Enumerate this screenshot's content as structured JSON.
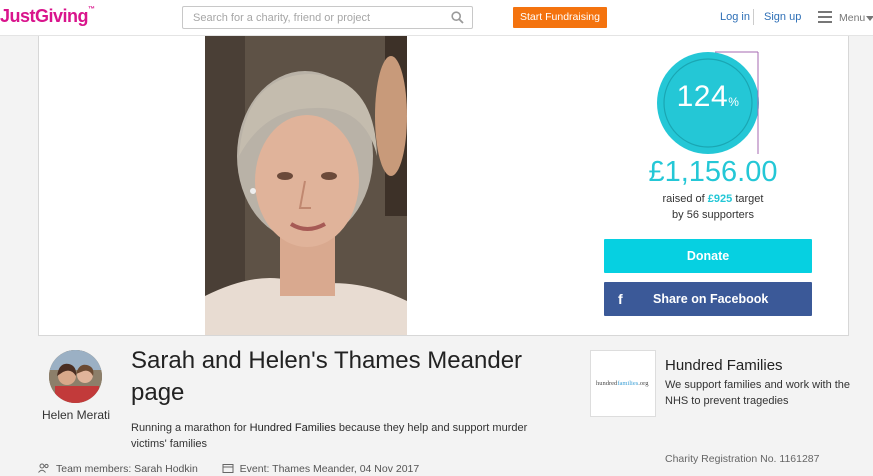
{
  "header": {
    "logo": "JustGiving",
    "logo_tm": "™",
    "search_placeholder": "Search for a charity, friend or project",
    "start_fundraising_label": "Start Fundraising",
    "login_label": "Log in",
    "signup_label": "Sign up",
    "menu_label": "Menu"
  },
  "progress": {
    "percent_value": "124",
    "percent_sign": "%",
    "fill_fraction": 1.0,
    "amount_raised": "£1,156.00",
    "raised_prefix": "raised of",
    "target": "£925",
    "raised_suffix": "target",
    "supporters_prefix": "by",
    "supporters_count": "56 supporters"
  },
  "actions": {
    "donate_label": "Donate",
    "facebook_icon": "f",
    "facebook_label": "Share on Facebook"
  },
  "owner": {
    "name": "Helen Merati"
  },
  "page": {
    "title": "Sarah and Helen's Thames Meander page",
    "desc_prefix": "Running a marathon for",
    "desc_charity": "Hundred Families",
    "desc_suffix": "because they help and support murder victims' families"
  },
  "meta": {
    "team_members": "Team members: Sarah Hodkin",
    "event": "Event: Thames Meander, 04 Nov 2017"
  },
  "charity": {
    "logo_text_a": "hundred",
    "logo_text_b": "families",
    "logo_text_c": ".org",
    "name": "Hundred Families",
    "description": "We support families and work with the NHS to prevent tragedies",
    "registration": "Charity Registration No. 1161287"
  },
  "colors": {
    "brand": "#d9148c",
    "accent": "#24c7d6",
    "start_button": "#f4730e",
    "donate_button": "#06d0e1",
    "facebook": "#3b5998",
    "link": "#2e6fb6"
  },
  "icons": {
    "search": "search-icon",
    "menu": "hamburger-icon",
    "facebook": "facebook-icon",
    "team": "people-icon",
    "event": "calendar-icon"
  }
}
